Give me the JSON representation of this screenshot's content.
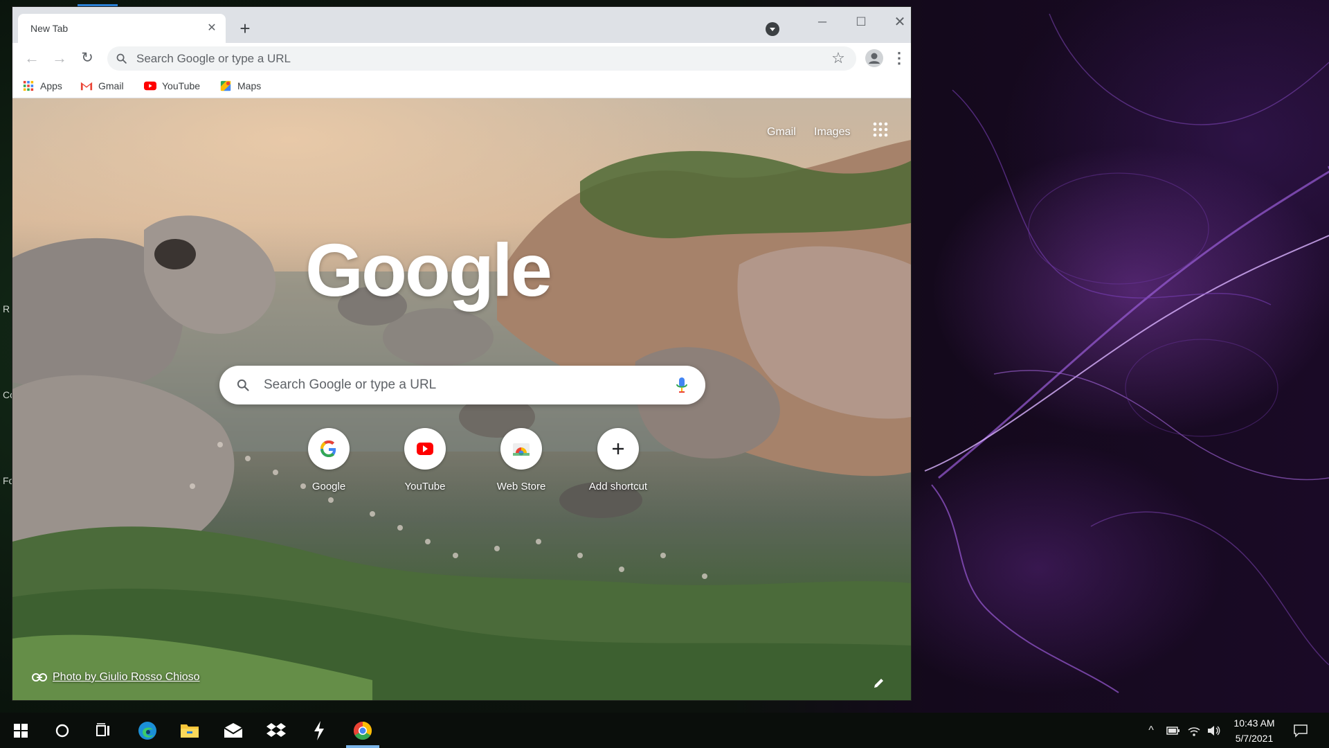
{
  "browser": {
    "tab_title": "New Tab",
    "tab_close_glyph": "✕",
    "new_tab_glyph": "+",
    "window_controls": {
      "minimize": "─",
      "maximize": "☐",
      "close": "✕"
    },
    "toolbar": {
      "back_glyph": "←",
      "forward_glyph": "→",
      "reload_glyph": "↻",
      "omnibox_placeholder": "Search Google or type a URL",
      "star_glyph": "☆",
      "menu_glyph": "⋮"
    },
    "bookmarks": [
      {
        "label": "Apps",
        "icon": "apps-grid-icon"
      },
      {
        "label": "Gmail",
        "icon": "gmail-icon"
      },
      {
        "label": "YouTube",
        "icon": "youtube-icon"
      },
      {
        "label": "Maps",
        "icon": "maps-icon"
      }
    ]
  },
  "ntp": {
    "top_links": [
      "Gmail",
      "Images"
    ],
    "logo_text": "Google",
    "search_placeholder": "Search Google or type a URL",
    "shortcuts": [
      {
        "label": "Google",
        "icon": "google-g-icon"
      },
      {
        "label": "YouTube",
        "icon": "youtube-icon"
      },
      {
        "label": "Web Store",
        "icon": "web-store-icon"
      },
      {
        "label": "Add shortcut",
        "icon": "plus-icon"
      }
    ],
    "attribution": "Photo by Giulio Rosso Chioso"
  },
  "desktop": {
    "edge_labels": [
      "R",
      "Co",
      "Fo"
    ]
  },
  "taskbar": {
    "pinned": [
      "windows-start-icon",
      "cortana-icon",
      "task-view-icon",
      "edge-icon",
      "file-explorer-icon",
      "mail-icon",
      "dropbox-icon",
      "app-icon",
      "chrome-icon"
    ],
    "tray": {
      "chevron_glyph": "^"
    },
    "time": "10:43 AM",
    "date": "5/7/2021"
  },
  "colors": {
    "tabstrip": "#dee1e6",
    "omnibox": "#f1f3f4",
    "google_blue": "#4285f4",
    "google_red": "#ea4335",
    "google_yellow": "#fbbc05",
    "google_green": "#34a853",
    "youtube_red": "#ff0000",
    "taskbar": "#0a0e0b"
  }
}
